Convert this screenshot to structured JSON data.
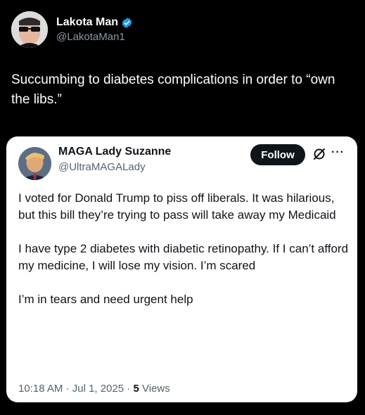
{
  "outer_post": {
    "author_name": "Lakota Man",
    "handle": "@LakotaMan1",
    "verified_color": "#1d9bf0",
    "text": "Succumbing to diabetes complications in order to “own the libs.”"
  },
  "quoted_post": {
    "author_name": "MAGA Lady Suzanne",
    "handle": "@UltraMAGALady",
    "follow_label": "Follow",
    "paragraphs": [
      "I voted for Donald Trump to piss off liberals. It was hilarious, but this bill they’re trying to pass will take away my Medicaid",
      "I have type 2 diabetes with diabetic retinopathy. If I can’t afford my medicine, I will lose my vision. I’m scared",
      "I’m in tears and need urgent help"
    ],
    "time": "10:18 AM",
    "separator": "·",
    "date": "Jul 1, 2025",
    "views_count": "5",
    "views_label": "Views",
    "icons": [
      "grok-icon",
      "more-icon"
    ]
  }
}
